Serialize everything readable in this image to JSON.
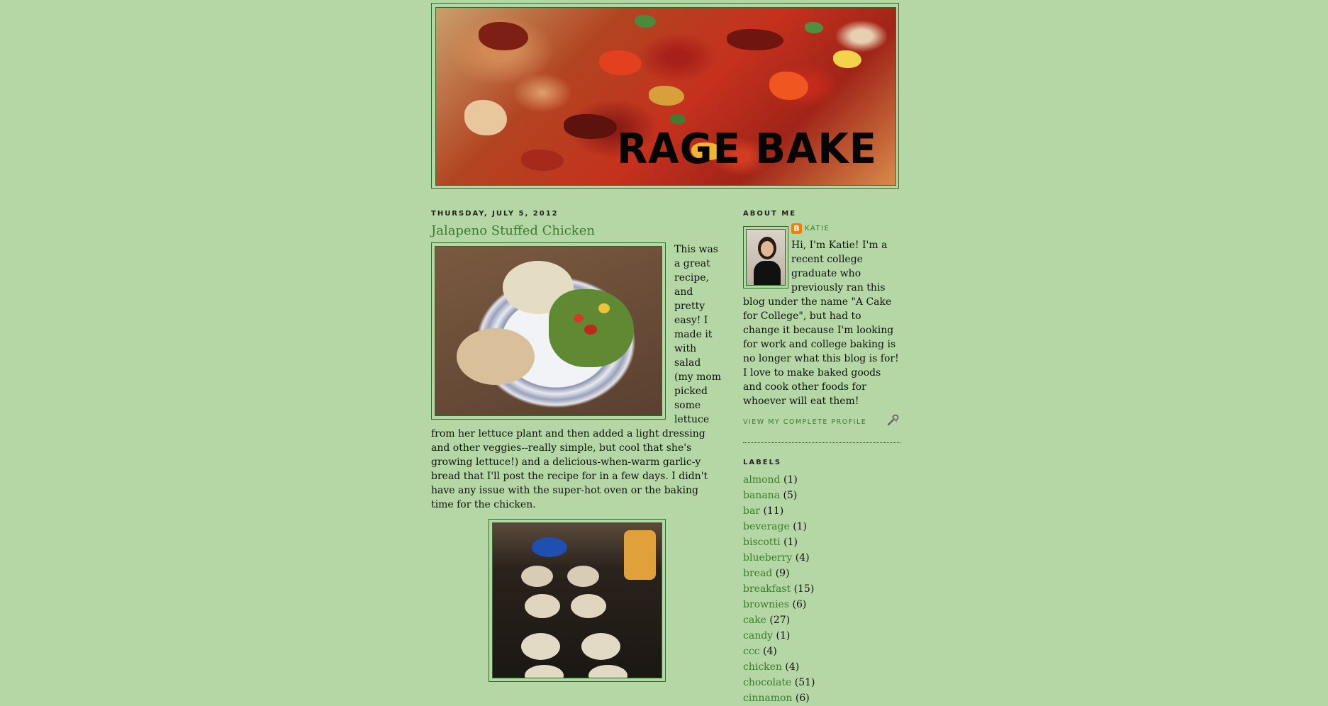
{
  "header": {
    "blog_title": "RAGE BAKE"
  },
  "post": {
    "date": "Thursday, July 5, 2012",
    "title": "Jalapeno Stuffed Chicken",
    "body": "This was a great recipe, and pretty easy! I made it with salad (my mom picked some lettuce from her lettuce plant and then added a light dressing and other veggies--really simple, but cool that she's growing lettuce!) and a delicious-when-warm garlic-y bread that I'll post the recipe for in a few days. I didn't have any issue with the super-hot oven or the baking time for the chicken."
  },
  "sidebar": {
    "about_title": "About Me",
    "profile_name": "Katie",
    "about_text": "Hi, I'm Katie! I'm a recent college graduate who previously ran this blog under the name \"A Cake for College\", but had to change it because I'm looking for work and college baking is no longer what this blog is for! I love to make baked goods and cook other foods for whoever will eat them!",
    "profile_link": "View my complete profile",
    "labels_title": "Labels",
    "labels": [
      {
        "name": "almond",
        "count": "(1)"
      },
      {
        "name": "banana",
        "count": "(5)"
      },
      {
        "name": "bar",
        "count": "(11)"
      },
      {
        "name": "beverage",
        "count": "(1)"
      },
      {
        "name": "biscotti",
        "count": "(1)"
      },
      {
        "name": "blueberry",
        "count": "(4)"
      },
      {
        "name": "bread",
        "count": "(9)"
      },
      {
        "name": "breakfast",
        "count": "(15)"
      },
      {
        "name": "brownies",
        "count": "(6)"
      },
      {
        "name": "cake",
        "count": "(27)"
      },
      {
        "name": "candy",
        "count": "(1)"
      },
      {
        "name": "ccc",
        "count": "(4)"
      },
      {
        "name": "chicken",
        "count": "(4)"
      },
      {
        "name": "chocolate",
        "count": "(51)"
      },
      {
        "name": "cinnamon",
        "count": "(6)"
      }
    ]
  },
  "colors": {
    "background": "#b5d7a6",
    "link": "#3b7b2e",
    "border": "#2f6a2a"
  }
}
